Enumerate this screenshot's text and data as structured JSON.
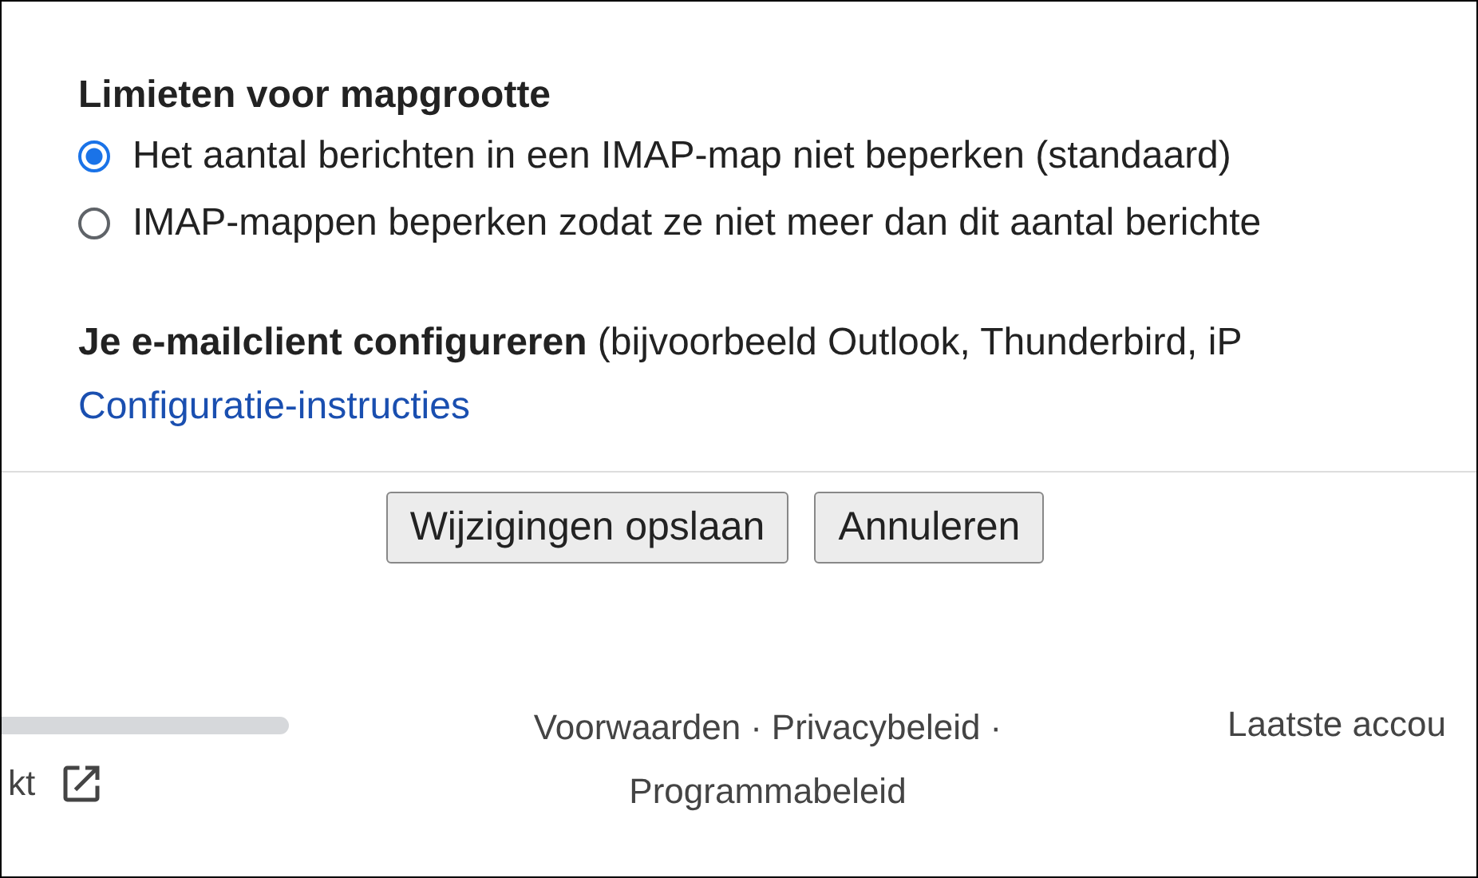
{
  "folder_limits": {
    "heading": "Limieten voor mapgrootte",
    "options": [
      {
        "label": "Het aantal berichten in een IMAP-map niet beperken (standaard)",
        "selected": true
      },
      {
        "label": "IMAP-mappen beperken zodat ze niet meer dan dit aantal berichte",
        "selected": false
      }
    ]
  },
  "client": {
    "heading": "Je e-mailclient configureren",
    "note": "(bijvoorbeeld Outlook, Thunderbird, iP",
    "link": "Configuratie-instructies"
  },
  "buttons": [
    {
      "label": "Wijzigingen opslaan"
    },
    {
      "label": "Annuleren"
    }
  ],
  "footer": {
    "left_text": "kt",
    "links": [
      "Voorwaarden",
      "Privacybeleid",
      "Programmabeleid"
    ],
    "separator": "·",
    "right_text": "Laatste accou"
  }
}
